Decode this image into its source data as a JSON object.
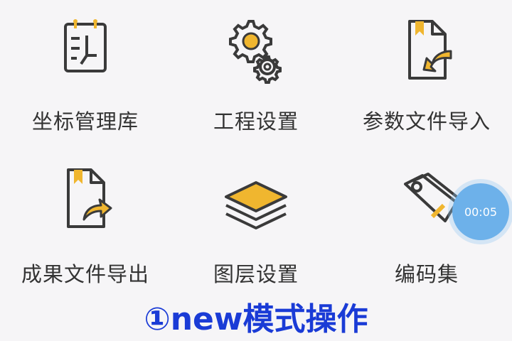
{
  "menu": {
    "items": [
      {
        "label": "坐标管理库",
        "icon": "coordinate-library-icon"
      },
      {
        "label": "工程设置",
        "icon": "gears-icon"
      },
      {
        "label": "参数文件导入",
        "icon": "file-import-icon"
      },
      {
        "label": "成果文件导出",
        "icon": "file-export-icon"
      },
      {
        "label": "图层设置",
        "icon": "layers-icon"
      },
      {
        "label": "编码集",
        "icon": "tag-icon"
      }
    ]
  },
  "timer": {
    "text": "00:05"
  },
  "caption": {
    "text": "①new模式操作"
  },
  "colors": {
    "accent": "#f0b62f",
    "stroke": "#3a3a3a",
    "timer": "#6db1ea",
    "caption": "#1a3bd6"
  }
}
